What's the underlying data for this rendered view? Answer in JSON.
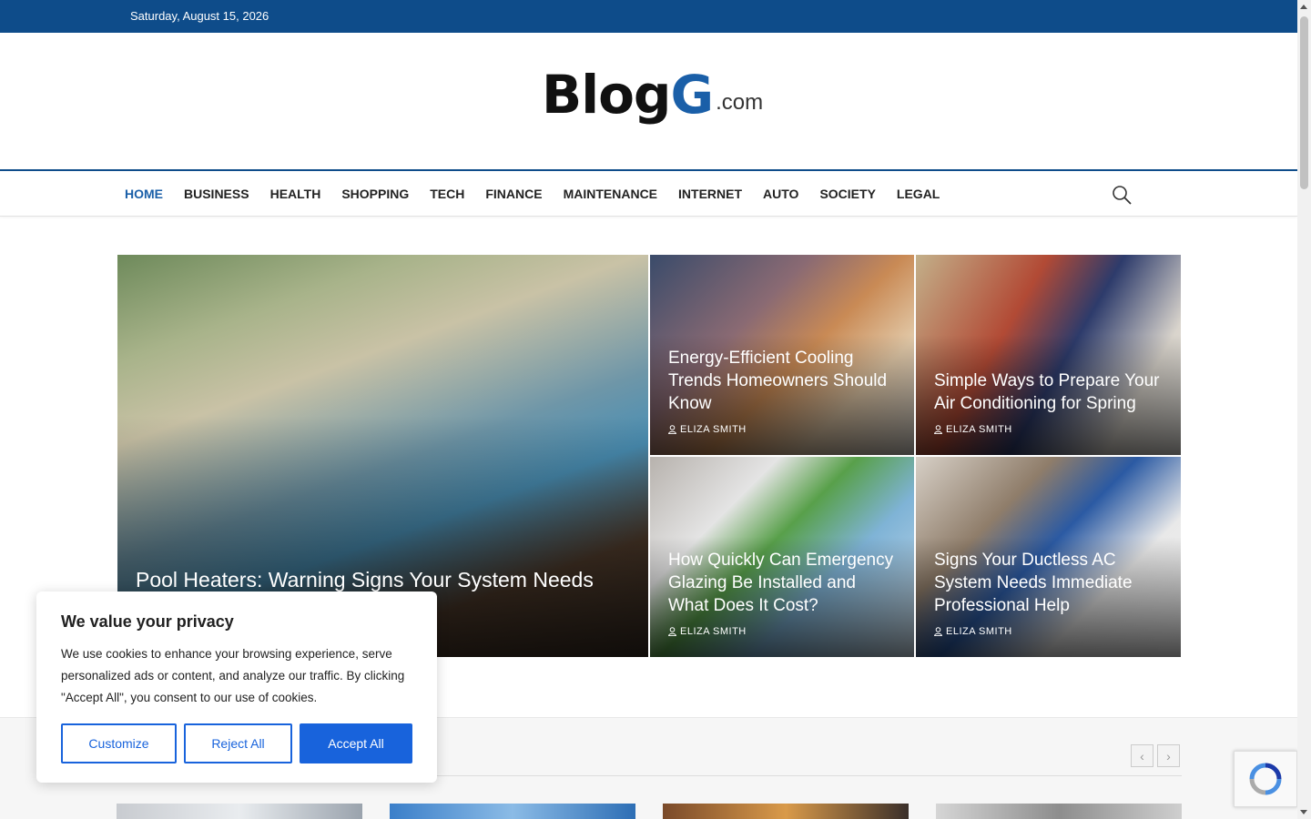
{
  "topbar": {
    "date": "Saturday, August 15, 2026"
  },
  "logo": {
    "main": "Blog",
    "accent": "G",
    "tld": ".com"
  },
  "nav": {
    "items": [
      {
        "label": "HOME",
        "active": true
      },
      {
        "label": "BUSINESS"
      },
      {
        "label": "HEALTH"
      },
      {
        "label": "SHOPPING"
      },
      {
        "label": "TECH"
      },
      {
        "label": "FINANCE"
      },
      {
        "label": "MAINTENANCE"
      },
      {
        "label": "INTERNET"
      },
      {
        "label": "AUTO"
      },
      {
        "label": "SOCIETY"
      },
      {
        "label": "LEGAL"
      }
    ],
    "search_icon": "search-icon"
  },
  "featured": {
    "main": {
      "title": "Pool Heaters: Warning Signs Your System Needs"
    },
    "tiles": [
      {
        "title": "Energy-Efficient Cooling Trends Homeowners Should Know",
        "author": "ELIZA SMITH"
      },
      {
        "title": "Simple Ways to Prepare Your Air Conditioning for Spring",
        "author": "ELIZA SMITH"
      },
      {
        "title": "How Quickly Can Emergency Glazing Be Installed and What Does It Cost?",
        "author": "ELIZA SMITH"
      },
      {
        "title": "Signs Your Ductless AC System Needs Immediate Professional Help",
        "author": "ELIZA SMITH"
      }
    ]
  },
  "carousel": {
    "prev_icon": "chevron-left-icon",
    "next_icon": "chevron-right-icon"
  },
  "cookie": {
    "heading": "We value your privacy",
    "body": "We use cookies to enhance your browsing experience, serve personalized ads or content, and analyze our traffic. By clicking \"Accept All\", you consent to our use of cookies.",
    "customize": "Customize",
    "reject": "Reject All",
    "accept": "Accept All"
  },
  "colors": {
    "brand": "#0e4c8a",
    "accent": "#1a5fa8",
    "cookie_button": "#1863dc"
  }
}
